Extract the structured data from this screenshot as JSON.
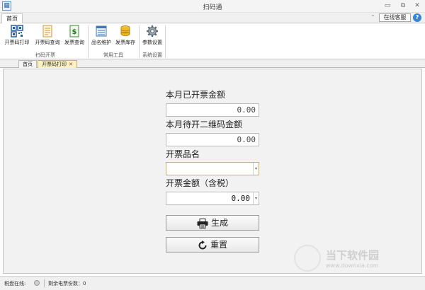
{
  "window": {
    "title": "扫码通",
    "app_icon": "qr-icon",
    "minimize": "▭",
    "restore": "⧉",
    "close": "✕"
  },
  "ribbon_tabs": {
    "home": "首页",
    "collapse_glyph": "⌃",
    "online_service": "在线客服",
    "help": "?"
  },
  "ribbon": {
    "groups": [
      {
        "label": "扫码开票",
        "buttons": [
          {
            "label": "开票码打印",
            "icon": "qr-code-icon"
          },
          {
            "label": "开票码查询",
            "icon": "document-icon"
          },
          {
            "label": "发票查询",
            "icon": "invoice-dollar-icon"
          }
        ]
      },
      {
        "label": "常用工具",
        "buttons": [
          {
            "label": "品名维护",
            "icon": "product-list-icon"
          },
          {
            "label": "发票库存",
            "icon": "coin-stack-icon"
          }
        ]
      },
      {
        "label": "系统设置",
        "buttons": [
          {
            "label": "参数设置",
            "icon": "gear-icon"
          }
        ]
      }
    ]
  },
  "doc_tabs": [
    {
      "label": "首页"
    },
    {
      "label": "开票码打印",
      "close": "✕",
      "active": true
    }
  ],
  "form": {
    "issued_label": "本月已开票金额",
    "issued_value": "0.00",
    "pending_label": "本月待开二维码金额",
    "pending_value": "0.00",
    "product_label": "开票品名",
    "product_value": "",
    "amount_label": "开票金额（含税）",
    "amount_value": "0.00",
    "generate_label": "生成",
    "reset_label": "重置"
  },
  "status": {
    "disk_label": "税盘在线:",
    "remaining_label": "剩余电票份数：0"
  },
  "watermark": {
    "text": "当下软件园",
    "url": "www.downxia.com"
  },
  "colors": {
    "active_tab": "#fbf2c4",
    "accent_blue": "#3a84d3",
    "panel_bg": "#f2f2f2"
  }
}
